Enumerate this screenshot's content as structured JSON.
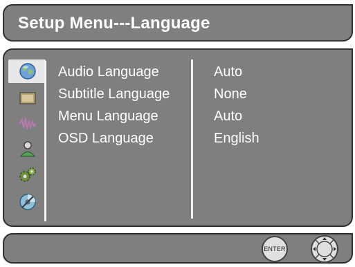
{
  "title": "Setup Menu---Language",
  "sidebar": {
    "icons": [
      {
        "name": "globe-language-icon",
        "selected": true
      },
      {
        "name": "display-monitor-icon",
        "selected": false
      },
      {
        "name": "audio-wave-icon",
        "selected": false
      },
      {
        "name": "user-profile-icon",
        "selected": false
      },
      {
        "name": "gears-settings-icon",
        "selected": false
      },
      {
        "name": "disc-icon",
        "selected": false
      }
    ]
  },
  "settings": [
    {
      "label": "Audio Language",
      "value": "Auto"
    },
    {
      "label": "Subtitle Language",
      "value": "None"
    },
    {
      "label": "Menu Language",
      "value": "Auto"
    },
    {
      "label": "OSD Language",
      "value": "English"
    }
  ],
  "footer": {
    "enter_label": "ENTER",
    "nav_icon": "directional-pad-icon"
  },
  "colors": {
    "panel": "#7f7f7f",
    "text": "#ffffff",
    "border": "#2f2f2f"
  }
}
